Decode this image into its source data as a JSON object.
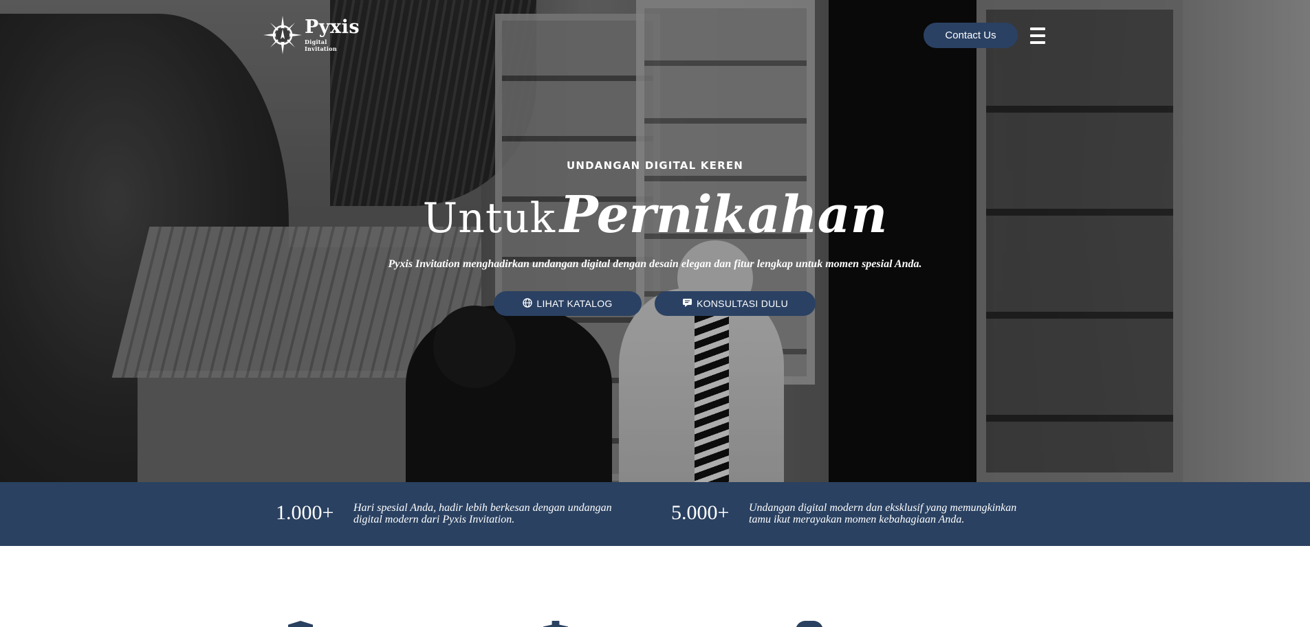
{
  "header": {
    "logo_name": "Pyxis",
    "logo_subtitle": "Digital Invitation",
    "contact_label": "Contact Us",
    "menu_icon": "hamburger-menu-icon"
  },
  "hero": {
    "eyebrow": "UNDANGAN DIGITAL KEREN",
    "headline_plain": "Untuk",
    "headline_script": "Pernikahan",
    "tagline": "Pyxis Invitation menghadirkan undangan digital dengan desain elegan dan fitur lengkap untuk momen spesial Anda.",
    "buttons": [
      {
        "label": "LIHAT KATALOG",
        "icon": "globe-icon"
      },
      {
        "label": "KONSULTASI DULU",
        "icon": "message-icon"
      }
    ]
  },
  "stats": [
    {
      "value": "1.000+",
      "description": "Hari spesial Anda, hadir lebih berkesan dengan undangan digital modern dari Pyxis Invitation."
    },
    {
      "value": "5.000+",
      "description": "Undangan digital modern dan eksklusif yang memungkinkan tamu ikut merayakan momen kebahagiaan Anda."
    }
  ],
  "colors": {
    "primary_navy": "#2a4163",
    "text_white": "#ffffff",
    "background": "#ffffff"
  }
}
